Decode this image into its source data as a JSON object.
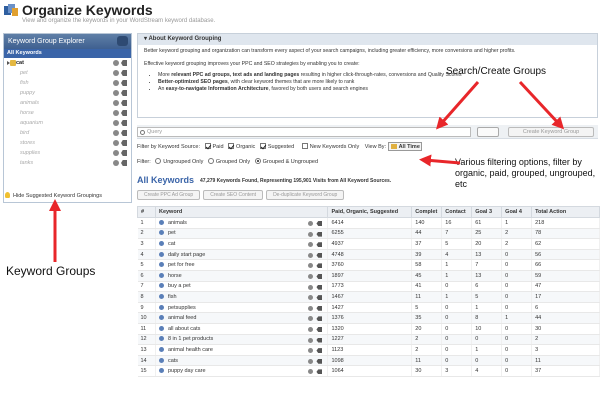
{
  "header": {
    "title": "Organize Keywords",
    "subtitle": "View and organize the keywords in your WordStream keyword database."
  },
  "left_panel": {
    "title": "Keyword Group Explorer",
    "all_label": "All Keywords",
    "groups": [
      "cat",
      "pet",
      "fish",
      "puppy",
      "animals",
      "horse",
      "aquarium",
      "bird",
      "stores",
      "supplies",
      "tanks"
    ],
    "hide_label": "Hide Suggested Keyword Groupings"
  },
  "about": {
    "title": "About Keyword Grouping",
    "p1": "Better keyword grouping and organization can transform every aspect of your search campaigns, including greater efficiency, more conversions and higher profits.",
    "p2": "Effective keyword grouping improves your PPC and SEO strategies by enabling you to create:",
    "b1_pre": "More ",
    "b1_bold": "relevant PPC ad groups, text ads and landing pages",
    "b1_post": " resulting in higher click-through-rates, conversions and Quality Scores",
    "b2_bold": "Better-optimized SEO pages",
    "b2_post": ", with clear keyword themes that are more likely to rank",
    "b3_pre": "An ",
    "b3_bold": "easy-to-navigate Information Architecture",
    "b3_post": ", favored by both users and search engines"
  },
  "search": {
    "placeholder": "Query",
    "create_label": "Create Keyword Group"
  },
  "filters": {
    "source_label": "Filter by Keyword Source:",
    "paid": "Paid",
    "organic": "Organic",
    "suggested": "Suggested",
    "new_only": "New Keywords Only",
    "view_by": "View By:",
    "view_value": "All Time",
    "filter_label": "Filter:",
    "ungrouped": "Ungrouped Only",
    "grouped": "Grouped Only",
    "both": "Grouped & Ungrouped"
  },
  "summary": {
    "title": "All Keywords",
    "text": "47,279 Keywords Found, Representing 195,901 Visits from All Keyword Sources."
  },
  "buttons": [
    "Create PPC Ad Group",
    "Create SEO Content",
    "De-duplicate Keyword Group"
  ],
  "table": {
    "headers": [
      "#",
      "Keyword",
      "Paid, Organic, Suggested",
      "Complet",
      "Contact",
      "Goal 3",
      "Goal 4",
      "Total Action"
    ],
    "rows": [
      [
        "1",
        "animals",
        "6414",
        "140",
        "16",
        "61",
        "1",
        "218"
      ],
      [
        "2",
        "pet",
        "6255",
        "44",
        "7",
        "25",
        "2",
        "78"
      ],
      [
        "3",
        "cat",
        "4937",
        "37",
        "5",
        "20",
        "2",
        "62"
      ],
      [
        "4",
        "daily start page",
        "4748",
        "39",
        "4",
        "13",
        "0",
        "56"
      ],
      [
        "5",
        "pet for free",
        "3760",
        "58",
        "1",
        "7",
        "0",
        "66"
      ],
      [
        "6",
        "horse",
        "1897",
        "45",
        "1",
        "13",
        "0",
        "59"
      ],
      [
        "7",
        "buy a pet",
        "1773",
        "41",
        "0",
        "6",
        "0",
        "47"
      ],
      [
        "8",
        "fish",
        "1467",
        "11",
        "1",
        "5",
        "0",
        "17"
      ],
      [
        "9",
        "petsupplies",
        "1427",
        "5",
        "0",
        "1",
        "0",
        "6"
      ],
      [
        "10",
        "animal feed",
        "1376",
        "35",
        "0",
        "8",
        "1",
        "44"
      ],
      [
        "11",
        "all about cats",
        "1320",
        "20",
        "0",
        "10",
        "0",
        "30"
      ],
      [
        "12",
        "8 in 1 pet products",
        "1227",
        "2",
        "0",
        "0",
        "0",
        "2"
      ],
      [
        "13",
        "animal health care",
        "1123",
        "2",
        "0",
        "1",
        "0",
        "3"
      ],
      [
        "14",
        "cats",
        "1098",
        "11",
        "0",
        "0",
        "0",
        "11"
      ],
      [
        "15",
        "puppy day care",
        "1064",
        "30",
        "3",
        "4",
        "0",
        "37"
      ]
    ]
  },
  "annotations": {
    "search": "Search/Create Groups",
    "filter": "Various filtering options, filter by organic, paid, grouped, ungrouped, etc",
    "groups": "Keyword Groups"
  },
  "colors": {
    "accent": "#3a64a8",
    "annotation_arrow": "#e8262a"
  }
}
